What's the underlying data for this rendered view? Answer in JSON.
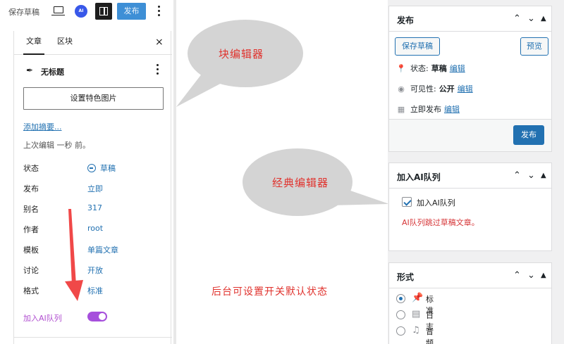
{
  "block_editor": {
    "topbar": {
      "save_draft": "保存草稿",
      "ai_badge": "AI",
      "publish": "发布"
    },
    "tabs": [
      "文章",
      "区块"
    ],
    "close": "×",
    "post_title": "无标题",
    "featured_image_button": "设置特色图片",
    "add_excerpt_link": "添加摘要...",
    "last_edited": "上次编辑 一秒 前。",
    "meta": [
      {
        "key": "状态",
        "value": "草稿"
      },
      {
        "key": "发布",
        "value": "立即"
      },
      {
        "key": "别名",
        "value": "317"
      },
      {
        "key": "作者",
        "value": "root"
      },
      {
        "key": "模板",
        "value": "单篇文章"
      },
      {
        "key": "讨论",
        "value": "开放"
      },
      {
        "key": "格式",
        "value": "标准"
      }
    ],
    "ai_queue_label": "加入AI队列",
    "ai_queue_enabled": true
  },
  "annotations": {
    "block_bubble": "块编辑器",
    "classic_bubble": "经典编辑器",
    "caption": "后台可设置开关默认状态",
    "colors": {
      "text": "#e0332e",
      "bubble": "#d4d4d4",
      "arrow": "#f04848"
    }
  },
  "classic_editor": {
    "publish_box": {
      "title": "发布",
      "save_draft": "保存草稿",
      "preview": "预览",
      "status_label": "状态:",
      "status_value": "草稿",
      "visibility_label": "可见性:",
      "visibility_value": "公开",
      "schedule_label": "立即发布",
      "edit_link": "编辑",
      "publish_button": "发布"
    },
    "ai_box": {
      "title": "加入AI队列",
      "checkbox_label": "加入AI队列",
      "checked": true,
      "note": "AI队列跳过草稿文章。"
    },
    "format_box": {
      "title": "形式",
      "options": [
        {
          "label": "标准",
          "icon": "pin-icon",
          "selected": true
        },
        {
          "label": "日志",
          "icon": "document-icon",
          "selected": false
        },
        {
          "label": "音频",
          "icon": "music-note-icon",
          "selected": false
        }
      ]
    },
    "accent": "#2271b1"
  }
}
